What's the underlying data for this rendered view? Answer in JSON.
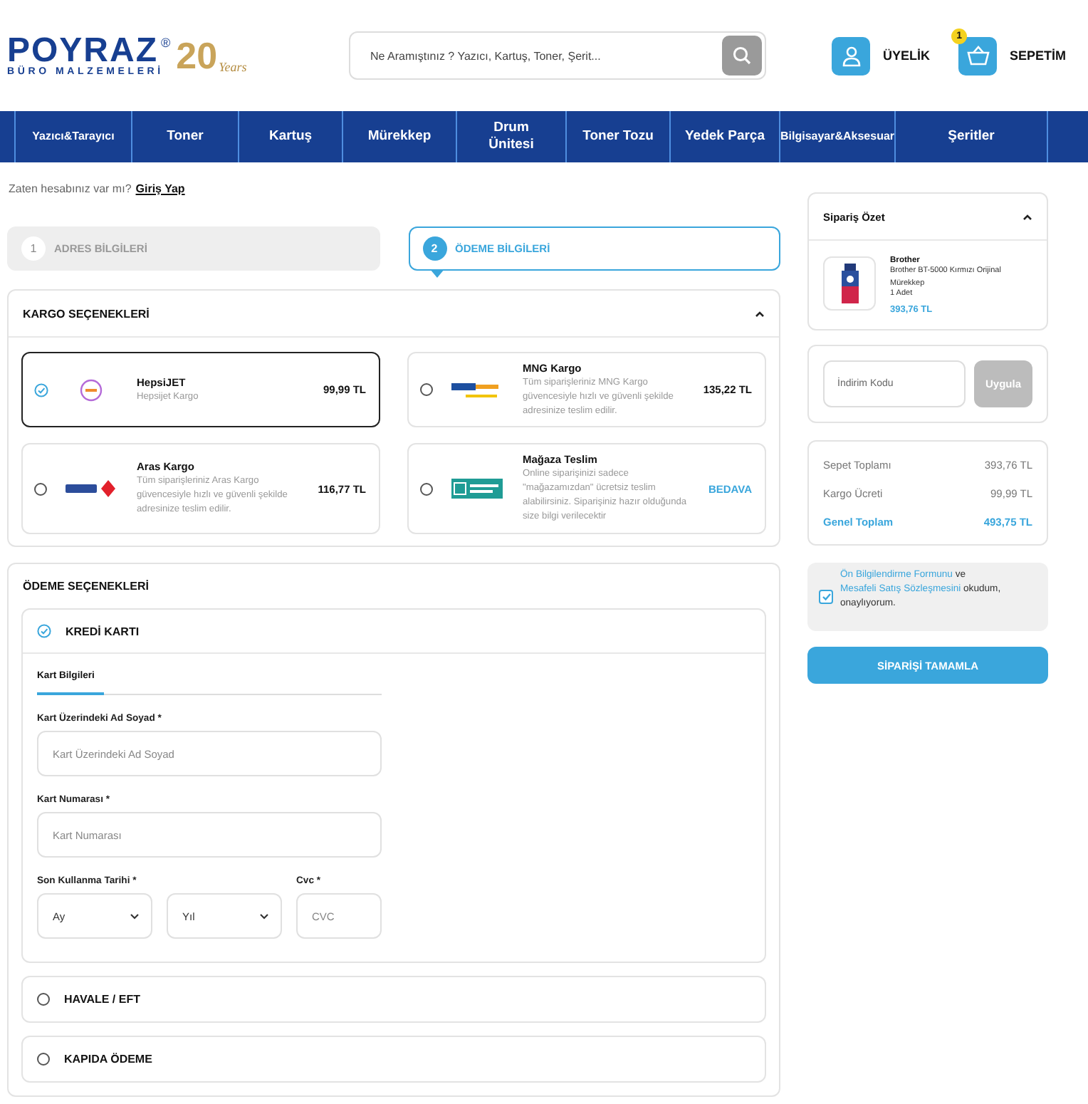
{
  "header": {
    "logo": {
      "name": "POYRAZ",
      "registered": "®",
      "tagline": "BÜRO MALZEMELERİ",
      "anniversary": "20",
      "anniversary_label": "Years"
    },
    "search": {
      "placeholder": "Ne Aramıştınız ? Yazıcı, Kartuş, Toner, Şerit..."
    },
    "account": {
      "label": "ÜYELİK"
    },
    "cart": {
      "label": "SEPETİM",
      "count": "1"
    }
  },
  "nav": [
    "Yazıcı&Tarayıcı",
    "Toner",
    "Kartuş",
    "Mürekkep",
    "Drum Ünitesi",
    "Toner Tozu",
    "Yedek Parça",
    "Bilgisayar&Aksesuar",
    "Şeritler"
  ],
  "login_prompt": {
    "text": "Zaten hesabınız var mı?",
    "link": "Giriş Yap"
  },
  "steps": [
    {
      "number": "1",
      "label": "ADRES BİLGİLERİ",
      "selected": false
    },
    {
      "number": "2",
      "label": "ÖDEME BİLGİLERİ",
      "selected": true
    }
  ],
  "shipping": {
    "title": "KARGO SEÇENEKLERİ",
    "expanded": true,
    "options": [
      {
        "kind": "hepsijet",
        "name": "HepsiJET",
        "description": "Hepsijet Kargo",
        "price": "99,99 TL",
        "free": false,
        "selected": true
      },
      {
        "kind": "mng",
        "name": "MNG Kargo",
        "description": "Tüm siparişleriniz MNG Kargo güvencesiyle hızlı ve güvenli şekilde adresinize teslim edilir.",
        "price": "135,22 TL",
        "free": false,
        "selected": false
      },
      {
        "kind": "aras",
        "name": "Aras Kargo",
        "description": "Tüm siparişleriniz Aras Kargo güvencesiyle hızlı ve güvenli şekilde adresinize teslim edilir.",
        "price": "116,77 TL",
        "free": false,
        "selected": false
      },
      {
        "kind": "store",
        "name": "Mağaza Teslim",
        "description": "Online siparişinizi sadece \"mağazamızdan\" ücretsiz teslim alabilirsiniz. Siparişiniz hazır olduğunda size bilgi verilecektir",
        "price": "BEDAVA",
        "free": true,
        "selected": false
      }
    ]
  },
  "payment": {
    "title": "ÖDEME SEÇENEKLERİ",
    "methods": [
      {
        "label": "KREDİ KARTI",
        "selected": true
      },
      {
        "label": "HAVALE / EFT",
        "selected": false
      },
      {
        "label": "KAPIDA ÖDEME",
        "selected": false
      }
    ],
    "card_form": {
      "tab": "Kart Bilgileri",
      "name_label": "Kart Üzerindeki Ad Soyad *",
      "name_placeholder": "Kart Üzerindeki Ad Soyad",
      "number_label": "Kart Numarası *",
      "number_placeholder": "Kart Numarası",
      "expiry_label": "Son Kullanma Tarihi *",
      "month": "Ay",
      "year": "Yıl",
      "cvc_label": "Cvc *",
      "cvc_placeholder": "CVC"
    }
  },
  "summary": {
    "title": "Sipariş Özet",
    "expanded": true,
    "item": {
      "brand": "Brother",
      "name": "Brother BT-5000 Kırmızı Orijinal Mürekkep",
      "quantity": "1 Adet",
      "price": "393,76 TL"
    },
    "promo": {
      "placeholder": "İndirim Kodu",
      "button": "Uygula",
      "disabled": true
    },
    "totals": [
      {
        "label": "Sepet Toplamı",
        "value": "393,76 TL",
        "kind": "line"
      },
      {
        "label": "Kargo Ücreti",
        "value": "99,99 TL",
        "kind": "line"
      },
      {
        "label": "Genel Toplam",
        "value": "493,75 TL",
        "kind": "total"
      }
    ],
    "agreement": {
      "checked": true,
      "link_1": "Ön Bilgilendirme Formunu",
      "joiner": "ve",
      "link_2": "Mesafeli Satış Sözleşmesini",
      "rest": "okudum, onaylıyorum."
    },
    "submit": "SİPARİŞİ TAMAMLA"
  }
}
